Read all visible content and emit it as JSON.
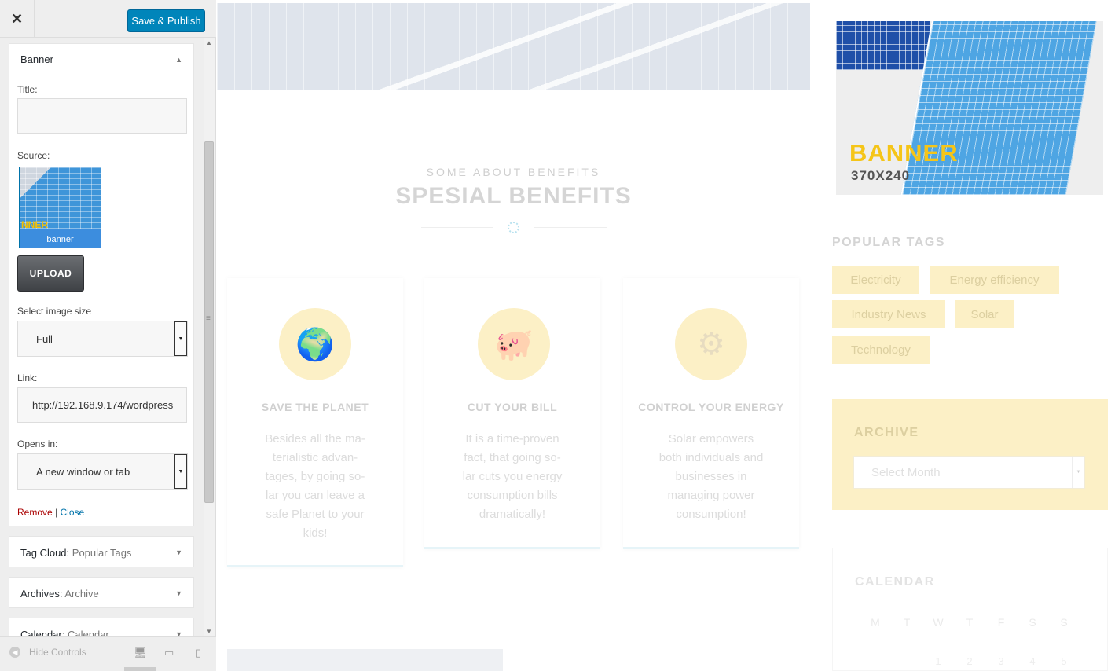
{
  "customizer": {
    "close_label": "✕",
    "publish_label": "Save & Publish",
    "banner_widget": {
      "title": "Banner",
      "title_label": "Title:",
      "title_value": "",
      "source_label": "Source:",
      "thumb_caption": "banner",
      "thumb_text": "NNER",
      "upload_label": "UPLOAD",
      "size_label": "Select image size",
      "size_value": "Full",
      "link_label": "Link:",
      "link_value": "http://192.168.9.174/wordpress",
      "opens_label": "Opens in:",
      "opens_value": "A new window or tab",
      "remove_label": "Remove",
      "separator": "|",
      "close_link_label": "Close"
    },
    "collapsed_widgets": [
      {
        "type": "Tag Cloud:",
        "name": "Popular Tags"
      },
      {
        "type": "Archives:",
        "name": "Archive"
      },
      {
        "type": "Calendar:",
        "name": "Calendar"
      }
    ],
    "footer": {
      "hide_controls": "Hide Controls"
    }
  },
  "preview": {
    "kicker": "SOME ABOUT BENEFITS",
    "heading": "SPESIAL BENEFITS",
    "cards": [
      {
        "title": "SAVE THE PLANET",
        "text": "Besides all the ma-terialistic advan-tages, by going so-lar you can leave a safe Planet to your kids!",
        "icon": "globe-hand-icon"
      },
      {
        "title": "CUT YOUR BILL",
        "text": "It is a time-proven fact, that going so-lar cuts you energy consumption bills dramatically!",
        "icon": "piggy-bank-icon"
      },
      {
        "title": "CONTROL YOUR ENERGY",
        "text": "Solar empowers both individuals and businesses in managing power consumption!",
        "icon": "gear-bolt-icon"
      }
    ],
    "banner": {
      "word": "BANNER",
      "size": "370X240"
    },
    "popular_tags": {
      "title": "POPULAR TAGS",
      "tags": [
        "Electricity",
        "Energy efficiency",
        "Industry News",
        "Solar",
        "Technology"
      ]
    },
    "archive": {
      "title": "ARCHIVE",
      "select_placeholder": "Select Month"
    },
    "calendar": {
      "title": "CALENDAR",
      "days": [
        "M",
        "T",
        "W",
        "T",
        "F",
        "S",
        "S"
      ],
      "first_row": [
        "1",
        "2",
        "3",
        "4",
        "5"
      ]
    },
    "colors": {
      "accent_yellow": "#fcf0c6",
      "publish_blue": "#0085ba"
    }
  }
}
